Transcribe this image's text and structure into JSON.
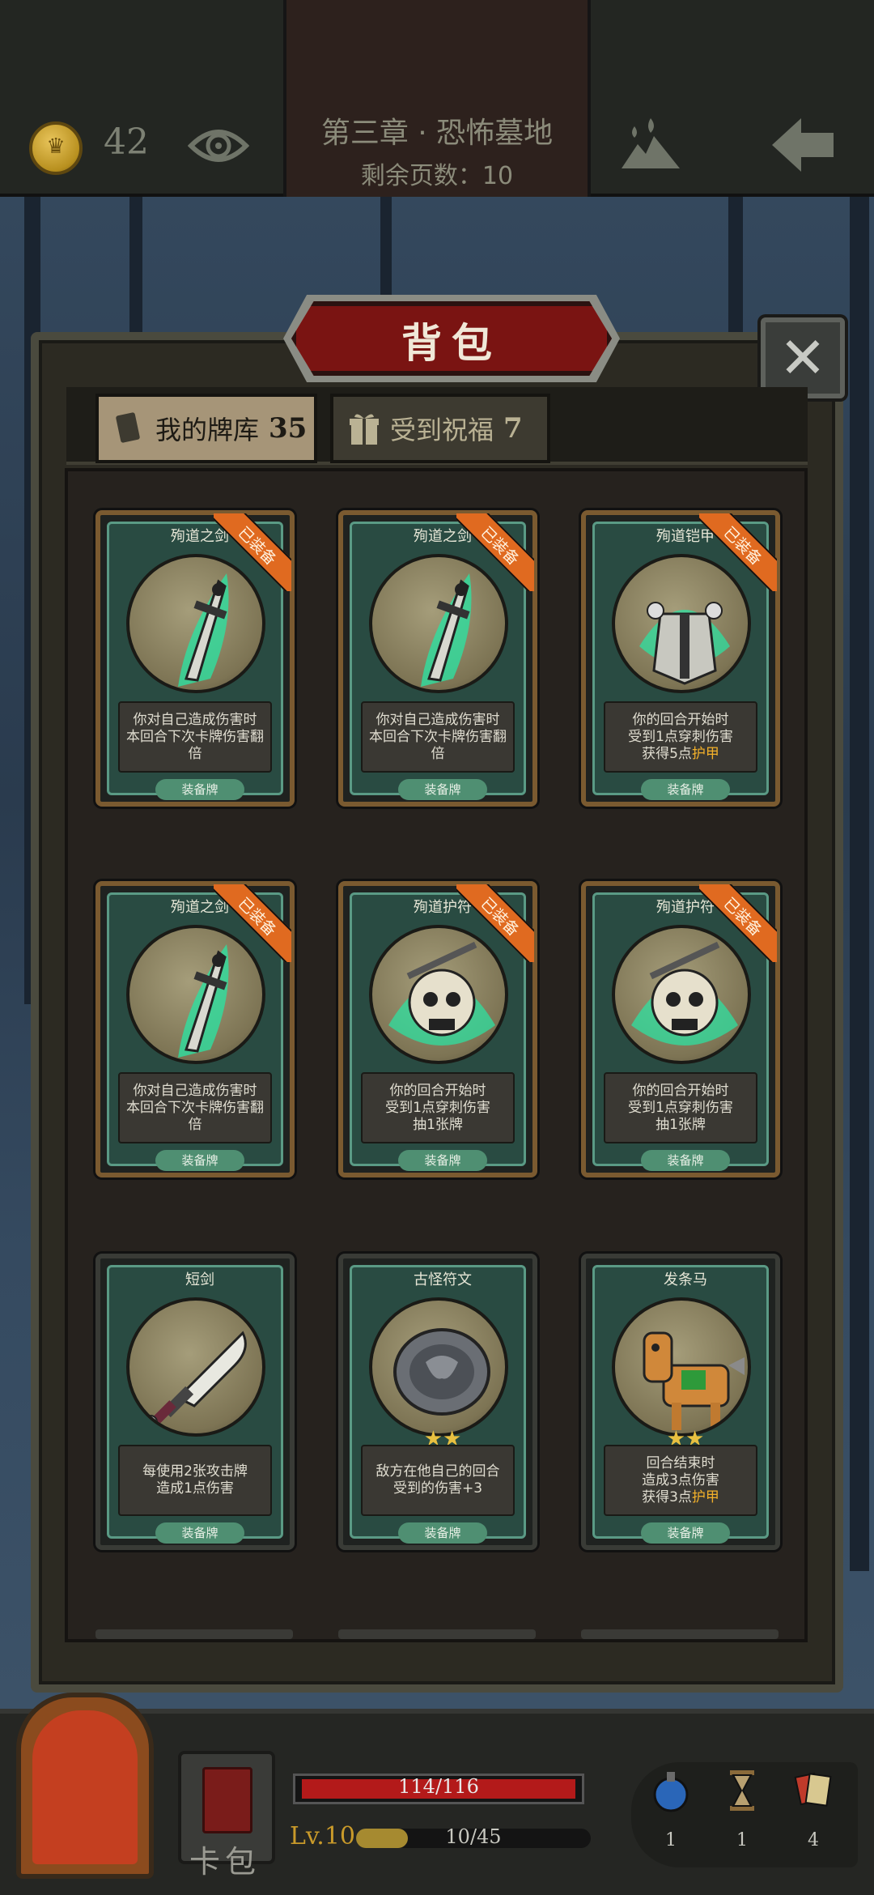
{
  "header": {
    "gold": "42",
    "chapter": "第三章 · 恐怖墓地",
    "pages_remaining": "剩余页数：10"
  },
  "panel": {
    "title": "背包",
    "close_symbol": "✕",
    "tabs": [
      {
        "label": "我的牌库",
        "count": "35",
        "active": true
      },
      {
        "label": "受到祝福",
        "count": "7",
        "active": false
      }
    ]
  },
  "cards": [
    {
      "name": "殉道之剑",
      "equipped_label": "已装备",
      "desc": [
        "你对自己造成伤害时",
        "本回合下次卡牌伤害翻倍"
      ],
      "type": "装备牌",
      "art": "sword"
    },
    {
      "name": "殉道之剑",
      "equipped_label": "已装备",
      "desc": [
        "你对自己造成伤害时",
        "本回合下次卡牌伤害翻倍"
      ],
      "type": "装备牌",
      "art": "sword"
    },
    {
      "name": "殉道铠甲",
      "equipped_label": "已装备",
      "desc": [
        "你的回合开始时",
        "受到1点穿刺伤害",
        "获得5点护甲"
      ],
      "type": "装备牌",
      "art": "armor"
    },
    {
      "name": "殉道之剑",
      "equipped_label": "已装备",
      "desc": [
        "你对自己造成伤害时",
        "本回合下次卡牌伤害翻倍"
      ],
      "type": "装备牌",
      "art": "sword"
    },
    {
      "name": "殉道护符",
      "equipped_label": "已装备",
      "desc": [
        "你的回合开始时",
        "受到1点穿刺伤害",
        "抽1张牌"
      ],
      "type": "装备牌",
      "art": "skull"
    },
    {
      "name": "殉道护符",
      "equipped_label": "已装备",
      "desc": [
        "你的回合开始时",
        "受到1点穿刺伤害",
        "抽1张牌"
      ],
      "type": "装备牌",
      "art": "skull"
    },
    {
      "name": "短剑",
      "equipped_label": "",
      "desc": [
        "每使用2张攻击牌",
        "造成1点伤害"
      ],
      "type": "装备牌",
      "art": "dagger",
      "stars": ""
    },
    {
      "name": "古怪符文",
      "equipped_label": "",
      "desc": [
        "敌方在他自己的回合",
        "受到的伤害+3"
      ],
      "type": "装备牌",
      "art": "rune",
      "stars": "★★"
    },
    {
      "name": "发条马",
      "equipped_label": "",
      "desc": [
        "回合结束时",
        "造成3点伤害",
        "获得3点护甲"
      ],
      "type": "装备牌",
      "art": "horse",
      "stars": "★★"
    }
  ],
  "bottom": {
    "deck_label": "卡包",
    "hp_text": "114/116",
    "hp_fraction": 0.983,
    "level": "Lv.10",
    "xp_text": "10/45",
    "xp_fraction": 0.222,
    "resources": [
      {
        "icon": "potion-icon",
        "count": "1"
      },
      {
        "icon": "hourglass-icon",
        "count": "1"
      },
      {
        "icon": "cards-icon",
        "count": "4"
      }
    ]
  },
  "colors": {
    "equipped_ribbon": "#e06a20",
    "hp": "#b31a1a",
    "highlight": "#f2b02a"
  }
}
